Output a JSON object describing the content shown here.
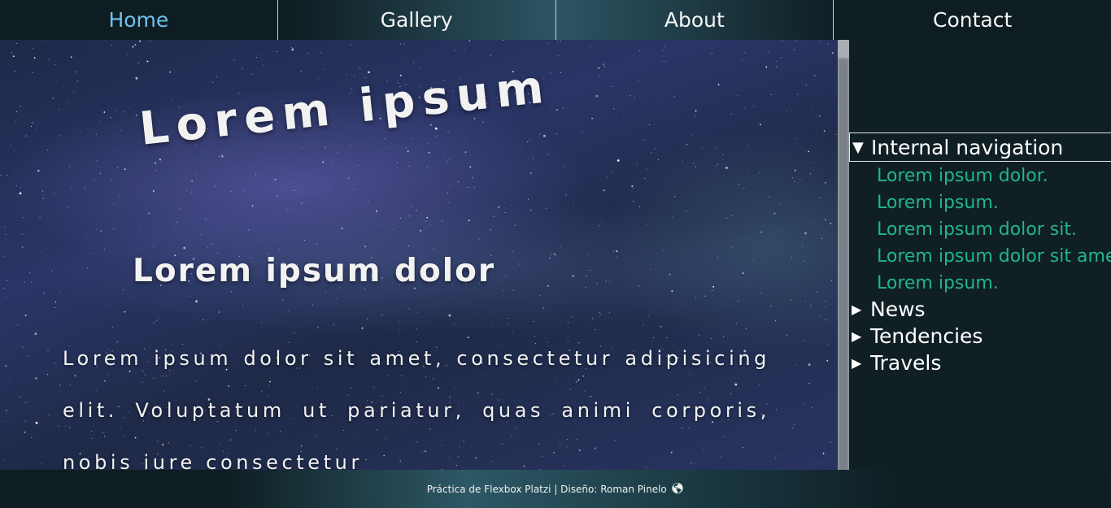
{
  "nav": {
    "items": [
      {
        "label": "Home",
        "active": true
      },
      {
        "label": "Gallery",
        "active": false
      },
      {
        "label": "About",
        "active": false
      },
      {
        "label": "Contact",
        "active": false
      }
    ]
  },
  "hero": {
    "title": "Lorem ipsum",
    "subtitle": "Lorem ipsum dolor",
    "paragraph": "Lorem ipsum dolor sit amet, consectetur adipisicing elit. Voluptatum ut pariatur, quas animi corporis, nobis iure consectetur"
  },
  "sidebar": {
    "open_section": {
      "label": "Internal navigation",
      "links": [
        "Lorem ipsum dolor.",
        "Lorem ipsum.",
        "Lorem ipsum dolor sit.",
        "Lorem ipsum dolor sit amet.",
        "Lorem ipsum."
      ]
    },
    "collapsed_sections": [
      "News",
      "Tendencies",
      "Travels"
    ]
  },
  "footer": {
    "text": "Práctica de Flexbox Platzi | Diseño: Roman Pinelo",
    "icon": "globe-icon"
  },
  "colors": {
    "background": "#0f1f24",
    "active_nav": "#6ec2ee",
    "sidebar_link": "#22b58c"
  }
}
